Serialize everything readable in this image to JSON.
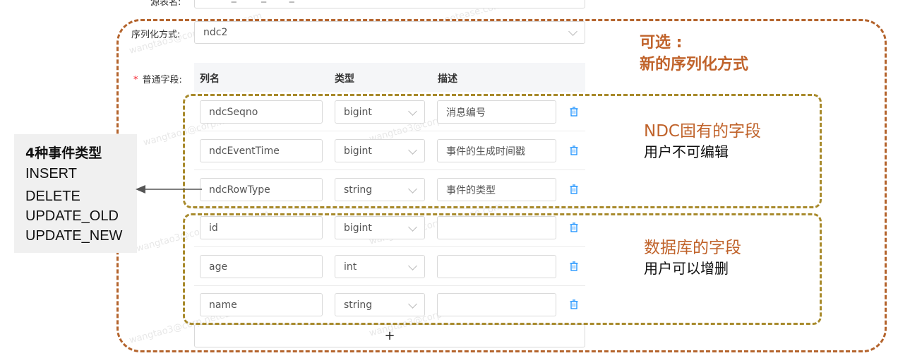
{
  "form": {
    "source_table_label": "源表名:",
    "source_table_value": "demo_table_from_ddb",
    "serialize_label": "序列化方式:",
    "serialize_value": "ndc2",
    "fields_label": "普通字段:",
    "required_mark": "*"
  },
  "table": {
    "headers": [
      "列名",
      "类型",
      "描述"
    ],
    "rows": [
      {
        "name": "ndcSeqno",
        "type": "bigint",
        "desc": "消息编号"
      },
      {
        "name": "ndcEventTime",
        "type": "bigint",
        "desc": "事件的生成时间戳"
      },
      {
        "name": "ndcRowType",
        "type": "string",
        "desc": "事件的类型"
      },
      {
        "name": "id",
        "type": "bigint",
        "desc": ""
      },
      {
        "name": "age",
        "type": "int",
        "desc": ""
      },
      {
        "name": "name",
        "type": "string",
        "desc": ""
      }
    ],
    "add_label": "+"
  },
  "annotations": {
    "optional": "可选 :",
    "optional_sub": "新的序列化方式",
    "ndc_title": "NDC固有的字段",
    "ndc_sub": "用户不可编辑",
    "db_title": "数据库的字段",
    "db_sub": "用户可以增删",
    "events_title": "4种事件类型",
    "events": [
      "INSERT",
      "DELETE",
      "UPDATE_OLD",
      "UPDATE_NEW"
    ]
  },
  "watermark": "wangtao3@corp.netease.com",
  "colors": {
    "outer_dash": "#b4642d",
    "inner_dash": "#a88a2c",
    "annotation_text": "#c0632b",
    "trash_icon": "#1890ff",
    "required": "#f5222d"
  }
}
